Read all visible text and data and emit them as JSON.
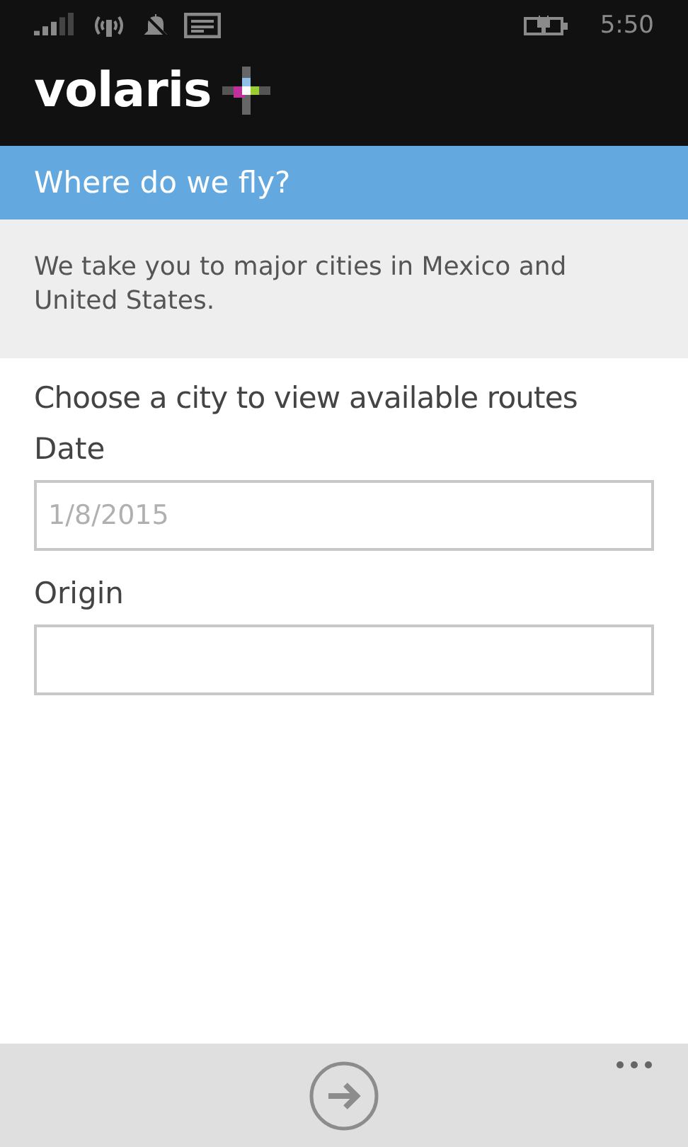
{
  "status_bar": {
    "time": "5:50"
  },
  "header": {
    "logo": "volaris"
  },
  "title_bar": {
    "title": "Where do we fly?"
  },
  "description": "We take you to major cities in Mexico and United States.",
  "form": {
    "heading": "Choose a city to view available routes",
    "fields": [
      {
        "label": "Date",
        "placeholder": "1/8/2015"
      },
      {
        "label": "Origin"
      }
    ]
  }
}
